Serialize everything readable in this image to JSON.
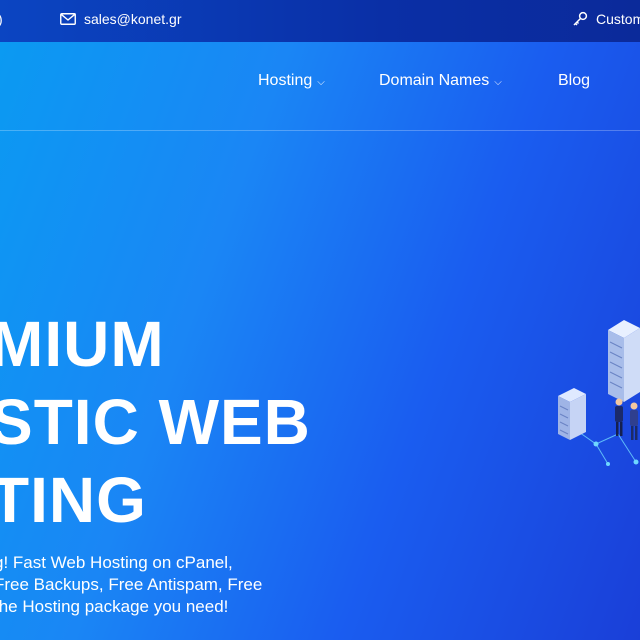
{
  "topbar": {
    "phone_fragment": ")",
    "email": "sales@konet.gr",
    "customer_label": "Custom"
  },
  "nav": {
    "items": [
      {
        "label": "Hosting",
        "has_dropdown": true
      },
      {
        "label": "Domain Names",
        "has_dropdown": true
      },
      {
        "label": "Blog",
        "has_dropdown": false
      }
    ]
  },
  "hero": {
    "title_lines": [
      "MIUM",
      "STIC WEB",
      "TING"
    ],
    "text_lines": [
      "g! Fast Web Hosting on cPanel,",
      "Free Backups, Free Antispam, Free",
      "the Hosting package you need!"
    ]
  },
  "icons": {
    "mail": "envelope-icon",
    "customer": "key-icon",
    "dropdown": "chevron-down-icon",
    "illustration": "server-rack-illustration"
  },
  "colors": {
    "topbar": "#0a2fa6",
    "hero_light": "#0a9bf2",
    "hero_dark": "#1a3fd8"
  }
}
